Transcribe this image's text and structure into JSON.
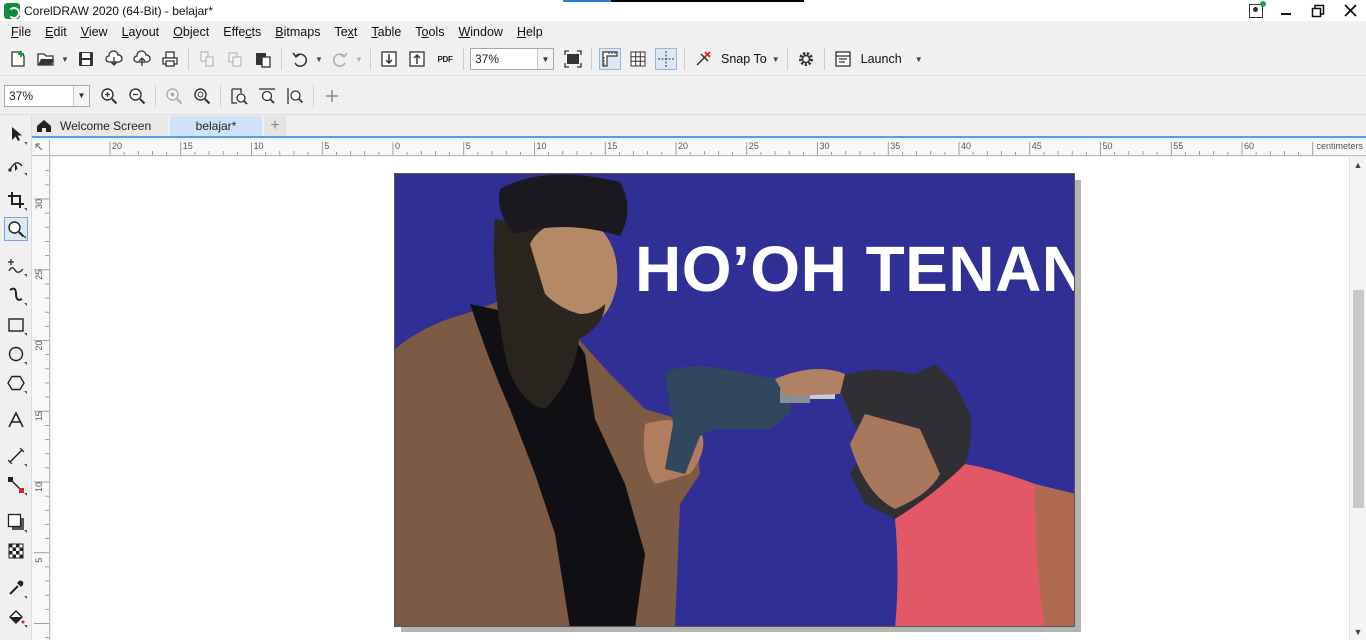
{
  "window": {
    "title": "CorelDRAW 2020 (64-Bit) - belajar*"
  },
  "menu": [
    {
      "label": "File",
      "key": "F",
      "rest": "ile"
    },
    {
      "label": "Edit",
      "key": "E",
      "rest": "dit"
    },
    {
      "label": "View",
      "key": "V",
      "rest": "iew"
    },
    {
      "label": "Layout",
      "key": "L",
      "rest": "ayout"
    },
    {
      "label": "Object",
      "key": "O",
      "rest": "bject"
    },
    {
      "label": "Effects",
      "key": "",
      "pre": "Effe",
      "key2": "c",
      "rest": "ts"
    },
    {
      "label": "Bitmaps",
      "key": "B",
      "rest": "itmaps"
    },
    {
      "label": "Text",
      "key": "",
      "pre": "Te",
      "key2": "x",
      "rest": "t"
    },
    {
      "label": "Table",
      "key": "T",
      "rest": "able"
    },
    {
      "label": "Tools",
      "key": "",
      "pre": "T",
      "key2": "o",
      "rest": "ols"
    },
    {
      "label": "Window",
      "key": "W",
      "rest": "indow"
    },
    {
      "label": "Help",
      "key": "H",
      "rest": "elp"
    }
  ],
  "toolbar": {
    "zoom_value": "37%",
    "snap_to_label": "Snap To",
    "launch_label": "Launch",
    "pdf_label": "PDF"
  },
  "propbar": {
    "zoom_value": "37%"
  },
  "tabs": {
    "welcome": "Welcome Screen",
    "document": "belajar*"
  },
  "ruler": {
    "units": "centimeters",
    "h_labels": [
      "20",
      "15",
      "10",
      "5",
      "0",
      "5",
      "10",
      "15",
      "20",
      "25",
      "30",
      "35",
      "40",
      "45",
      "50",
      "55",
      "60"
    ],
    "v_labels": [
      "30",
      "25",
      "20",
      "15",
      "10",
      "5"
    ]
  },
  "document": {
    "meme_text": "HO’OH TENAN",
    "background_color": "#2f2f95"
  }
}
